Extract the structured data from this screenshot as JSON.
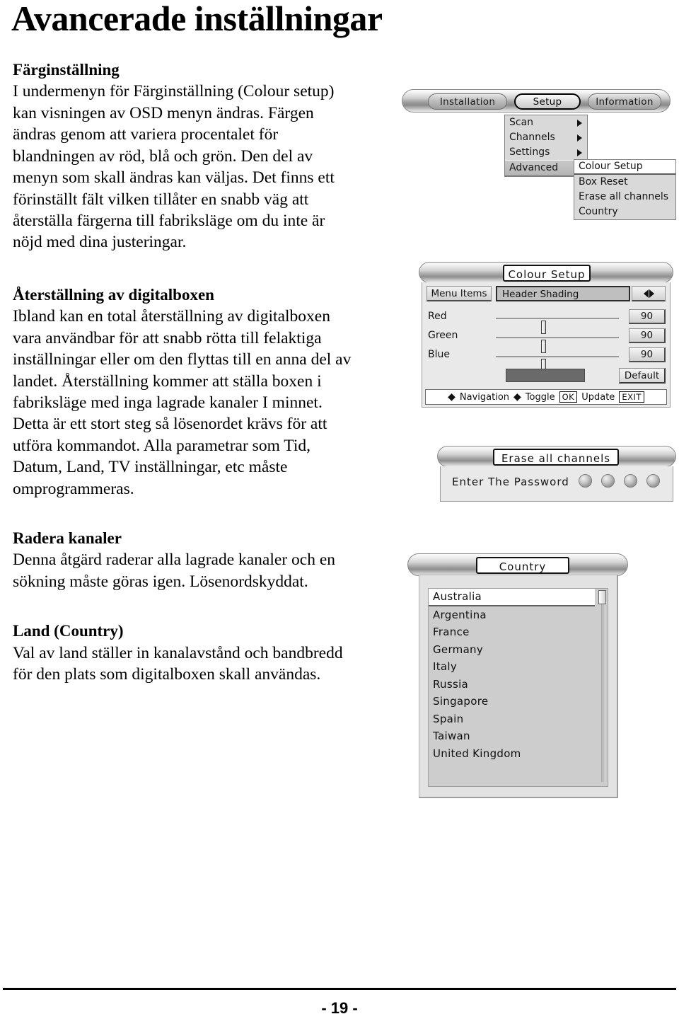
{
  "document": {
    "title": "Avancerade inställningar",
    "page_number": "- 19 -"
  },
  "sections": [
    {
      "heading": "Färginställning",
      "body": "I undermenyn för Färginställning (Colour setup) kan visningen av OSD menyn ändras. Färgen ändras genom att variera procentalet för blandningen av röd, blå och grön. Den del av menyn som skall ändras kan väljas. Det finns ett förinställt fält vilken tillåter en snabb väg att återställa färgerna till fabriksläge om du inte är nöjd med dina justeringar."
    },
    {
      "heading": "Återställning av digitalboxen",
      "body": "Ibland kan en total återställning av digitalboxen vara användbar för att snabb rötta till felaktiga inställningar eller om den flyttas till en anna del av landet. Återställning kommer att ställa boxen i fabriksläge med inga lagrade kanaler I minnet. Detta är ett stort steg så lösenordet krävs för att utföra kommandot. Alla parametrar som Tid, Datum, Land, TV inställningar, etc måste omprogrammeras."
    },
    {
      "heading": "Radera kanaler",
      "body": "Denna åtgärd raderar alla lagrade kanaler och en sökning måste göras igen. Lösenordskyddat."
    },
    {
      "heading": "Land (Country)",
      "body": "Val av land ställer in kanalavstånd och bandbredd för den plats som digitalboxen skall användas."
    }
  ],
  "figures": {
    "menu_tree": {
      "tabs": [
        {
          "label": "Installation",
          "selected": false
        },
        {
          "label": "Setup",
          "selected": true
        },
        {
          "label": "Information",
          "selected": false
        }
      ],
      "menu_level_1": [
        {
          "label": "Scan",
          "has_submenu": true,
          "highlighted": false
        },
        {
          "label": "Channels",
          "has_submenu": true,
          "highlighted": false
        },
        {
          "label": "Settings",
          "has_submenu": true,
          "highlighted": false
        },
        {
          "label": "Advanced",
          "has_submenu": true,
          "highlighted": true
        }
      ],
      "menu_level_2": [
        {
          "label": "Colour Setup",
          "highlighted": true
        },
        {
          "label": "Box Reset",
          "highlighted": false
        },
        {
          "label": "Erase all channels",
          "highlighted": false
        },
        {
          "label": "Country",
          "highlighted": false
        }
      ]
    },
    "colour_setup": {
      "title": "Colour Setup",
      "menu_items_label": "Menu Items",
      "menu_items_value": "Header Shading",
      "sliders": [
        {
          "name": "Red",
          "value": "90",
          "position_percent": 37
        },
        {
          "name": "Green",
          "value": "90",
          "position_percent": 37
        },
        {
          "name": "Blue",
          "value": "90",
          "position_percent": 37
        }
      ],
      "preview_colour": "#6a6a6a",
      "default_button": "Default",
      "navbar": {
        "navigation": "Navigation",
        "toggle": "Toggle",
        "ok_key": "OK",
        "update": "Update",
        "exit_key": "EXIT"
      }
    },
    "erase_all_channels": {
      "title": "Erase all channels",
      "prompt": "Enter The Password",
      "dot_count": 4
    },
    "country": {
      "title": "Country",
      "items": [
        {
          "label": "Australia",
          "selected": true
        },
        {
          "label": "Argentina",
          "selected": false
        },
        {
          "label": "France",
          "selected": false
        },
        {
          "label": "Germany",
          "selected": false
        },
        {
          "label": "Italy",
          "selected": false
        },
        {
          "label": "Russia",
          "selected": false
        },
        {
          "label": "Singapore",
          "selected": false
        },
        {
          "label": "Spain",
          "selected": false
        },
        {
          "label": "Taiwan",
          "selected": false
        },
        {
          "label": "United Kingdom",
          "selected": false
        }
      ]
    }
  }
}
